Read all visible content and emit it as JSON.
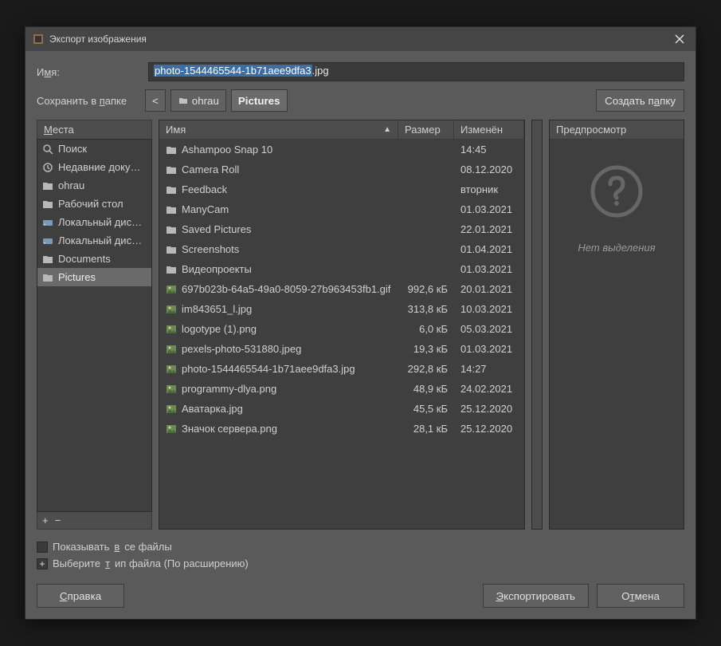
{
  "dialog": {
    "title": "Экспорт изображения"
  },
  "name": {
    "label_pre": "И",
    "label_ul": "м",
    "label_post": "я:",
    "value_selected": "photo-1544465544-1b71aee9dfa3",
    "value_ext": ".jpg"
  },
  "savein": {
    "label_pre": "Сохранить в ",
    "label_ul": "п",
    "label_post": "апке"
  },
  "path": {
    "back": "<",
    "seg1": "ohrau",
    "seg2": "Pictures"
  },
  "create_folder": {
    "pre": "Создать п",
    "ul": "а",
    "post": "пку"
  },
  "places": {
    "header_ul": "М",
    "header_post": "еста",
    "items": [
      {
        "icon": "search",
        "label": "Поиск"
      },
      {
        "icon": "recent",
        "label": "Недавние доку…"
      },
      {
        "icon": "folder",
        "label": "ohrau"
      },
      {
        "icon": "folder",
        "label": "Рабочий стол"
      },
      {
        "icon": "disk",
        "label": "Локальный дис…"
      },
      {
        "icon": "disk",
        "label": "Локальный дис…"
      },
      {
        "icon": "folder",
        "label": "Documents"
      },
      {
        "icon": "folder",
        "label": "Pictures",
        "selected": true
      }
    ],
    "add": "+",
    "remove": "−"
  },
  "filelist": {
    "col_name": "Имя",
    "col_size": "Размер",
    "col_mod": "Изменён",
    "rows": [
      {
        "icon": "folder",
        "name": "Ashampoo Snap 10",
        "size": "",
        "mod": "14:45"
      },
      {
        "icon": "folder",
        "name": "Camera Roll",
        "size": "",
        "mod": "08.12.2020"
      },
      {
        "icon": "folder",
        "name": "Feedback",
        "size": "",
        "mod": "вторник"
      },
      {
        "icon": "folder",
        "name": "ManyCam",
        "size": "",
        "mod": "01.03.2021"
      },
      {
        "icon": "folder",
        "name": "Saved Pictures",
        "size": "",
        "mod": "22.01.2021"
      },
      {
        "icon": "folder",
        "name": "Screenshots",
        "size": "",
        "mod": "01.04.2021"
      },
      {
        "icon": "folder",
        "name": "Видеопроекты",
        "size": "",
        "mod": "01.03.2021"
      },
      {
        "icon": "image",
        "name": "697b023b-64a5-49a0-8059-27b963453fb1.gif",
        "size": "992,6 кБ",
        "mod": "20.01.2021"
      },
      {
        "icon": "image",
        "name": "im843651_l.jpg",
        "size": "313,8 кБ",
        "mod": "10.03.2021"
      },
      {
        "icon": "image",
        "name": "logotype (1).png",
        "size": "6,0 кБ",
        "mod": "05.03.2021"
      },
      {
        "icon": "image",
        "name": "pexels-photo-531880.jpeg",
        "size": "19,3 кБ",
        "mod": "01.03.2021"
      },
      {
        "icon": "image",
        "name": "photo-1544465544-1b71aee9dfa3.jpg",
        "size": "292,8 кБ",
        "mod": "14:27"
      },
      {
        "icon": "image",
        "name": "programmy-dlya.png",
        "size": "48,9 кБ",
        "mod": "24.02.2021"
      },
      {
        "icon": "image",
        "name": "Аватарка.jpg",
        "size": "45,5 кБ",
        "mod": "25.12.2020"
      },
      {
        "icon": "image",
        "name": "Значок сервера.png",
        "size": "28,1 кБ",
        "mod": "25.12.2020"
      }
    ]
  },
  "preview": {
    "header": "Предпросмотр",
    "empty": "Нет выделения"
  },
  "options": {
    "show_all_pre": "Показывать ",
    "show_all_ul": "в",
    "show_all_post": "се файлы",
    "file_type_pre": "Выберите ",
    "file_type_ul": "т",
    "file_type_post": "ип файла (По расширению)"
  },
  "buttons": {
    "help_ul": "С",
    "help_post": "правка",
    "export_ul": "Э",
    "export_post": "кспортировать",
    "cancel_pre": "О",
    "cancel_ul": "т",
    "cancel_post": "мена"
  }
}
